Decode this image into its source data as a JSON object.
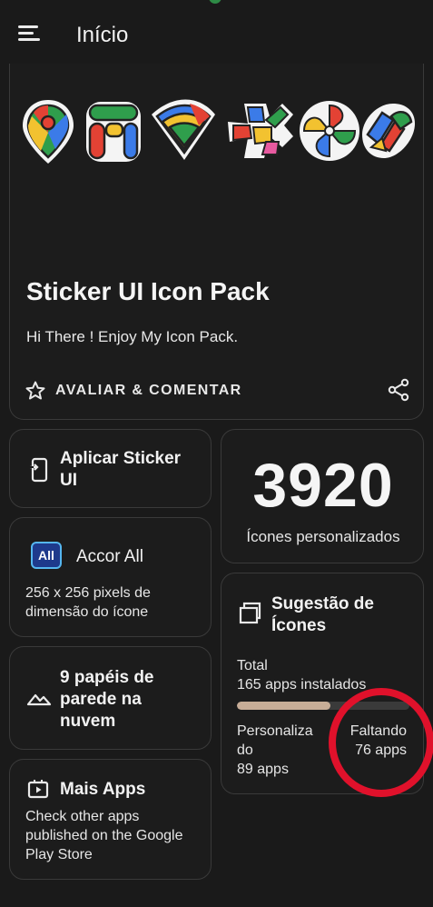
{
  "header": {
    "title": "Início",
    "menu_icon": "hamburger-menu-icon"
  },
  "hero": {
    "title": "Sticker UI Icon Pack",
    "subtitle": "Hi There ! Enjoy My Icon Pack.",
    "rate_label": "AVALIAR & COMENTAR",
    "icons": [
      "maps-pin-icon",
      "fi-letters-icon",
      "wifi-shield-icon",
      "puzzle-plus-icon",
      "pinwheel-icon",
      "sticker-app-icon"
    ]
  },
  "apply": {
    "label": "Aplicar Sticker UI"
  },
  "count": {
    "value": "3920",
    "caption": "Ícones personalizados"
  },
  "accor": {
    "label": "Accor All",
    "badge": "All",
    "desc": "256 x 256 pixels de dimensão do ícone"
  },
  "suggestion": {
    "title": "Sugestão de Ícones",
    "total_label": "Total",
    "installed": "165 apps instalados",
    "progress": 0.54,
    "customized_label": "Personaliza do",
    "customized_count": "89 apps",
    "missing_label": "Faltando",
    "missing_count": "76 apps"
  },
  "wallpapers": {
    "label": "9 papéis de parede na nuvem"
  },
  "more_apps": {
    "label": "Mais Apps",
    "desc": "Check other apps published on the Google Play Store"
  },
  "colors": {
    "background": "#1a1a1a",
    "card_border": "#3a3a3a",
    "progress_fill": "#c7ad97",
    "progress_track": "#3a3a3a",
    "annotation_red": "#e0112b"
  }
}
